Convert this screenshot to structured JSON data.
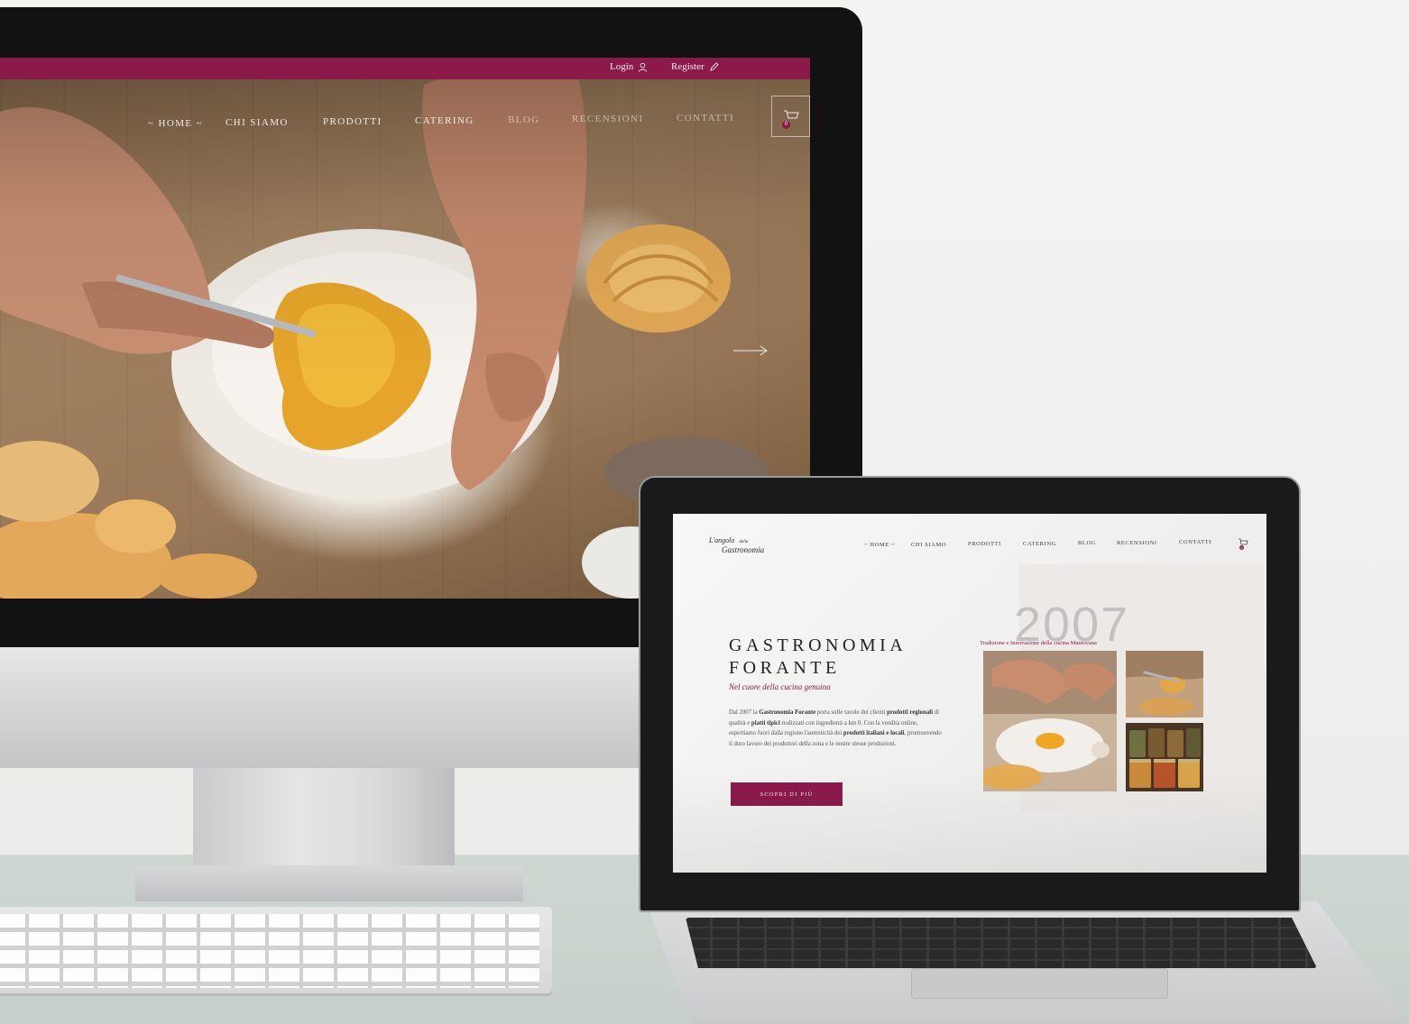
{
  "desktop": {
    "topbar": {
      "login_label": "Login",
      "register_label": "Register"
    },
    "nav": {
      "home": "~ Home ~",
      "chi_siamo": "Chi Siamo",
      "prodotti": "Prodotti",
      "catering": "Catering",
      "blog": "Blog",
      "recensioni": "Recensioni",
      "contatti": "Contatti"
    },
    "cart_count": "0",
    "colors": {
      "brand": "#8b1a4a"
    }
  },
  "laptop": {
    "logo": {
      "line1": "L'angolo",
      "line2": "della",
      "line3": "Gastronomia"
    },
    "nav": {
      "home": "~ Home ~",
      "chi_siamo": "Chi Siamo",
      "prodotti": "Prodotti",
      "catering": "Catering",
      "blog": "Blog",
      "recensioni": "Recensioni",
      "contatti": "Contatti"
    },
    "cart_count": "0",
    "year": "2007",
    "tagline": "Tradizione e Innovazione della cucina Mantovana",
    "title_line1": "Gastronomia",
    "title_line2": "Forante",
    "subtitle": "Nel cuore della cucina genuina",
    "body": {
      "p1": "Dal 2007 la ",
      "b1": "Gastronomia Forante",
      "p2": " porta sulle tavole dei clienti ",
      "b2": "prodotti regionali",
      "p3": " di qualità e ",
      "b3": "piatti tipici",
      "p4": " realizzati con ingredienti a km 0. Con la vendita online, esportiamo fuori dalla regione l'autenticità dei ",
      "b4": "prodotti italiani e locali",
      "p5": ", promuovendo il duro lavoro dei produttori della zona e le nostre stesse produzioni."
    },
    "cta_label": "Scopri Di Più"
  }
}
